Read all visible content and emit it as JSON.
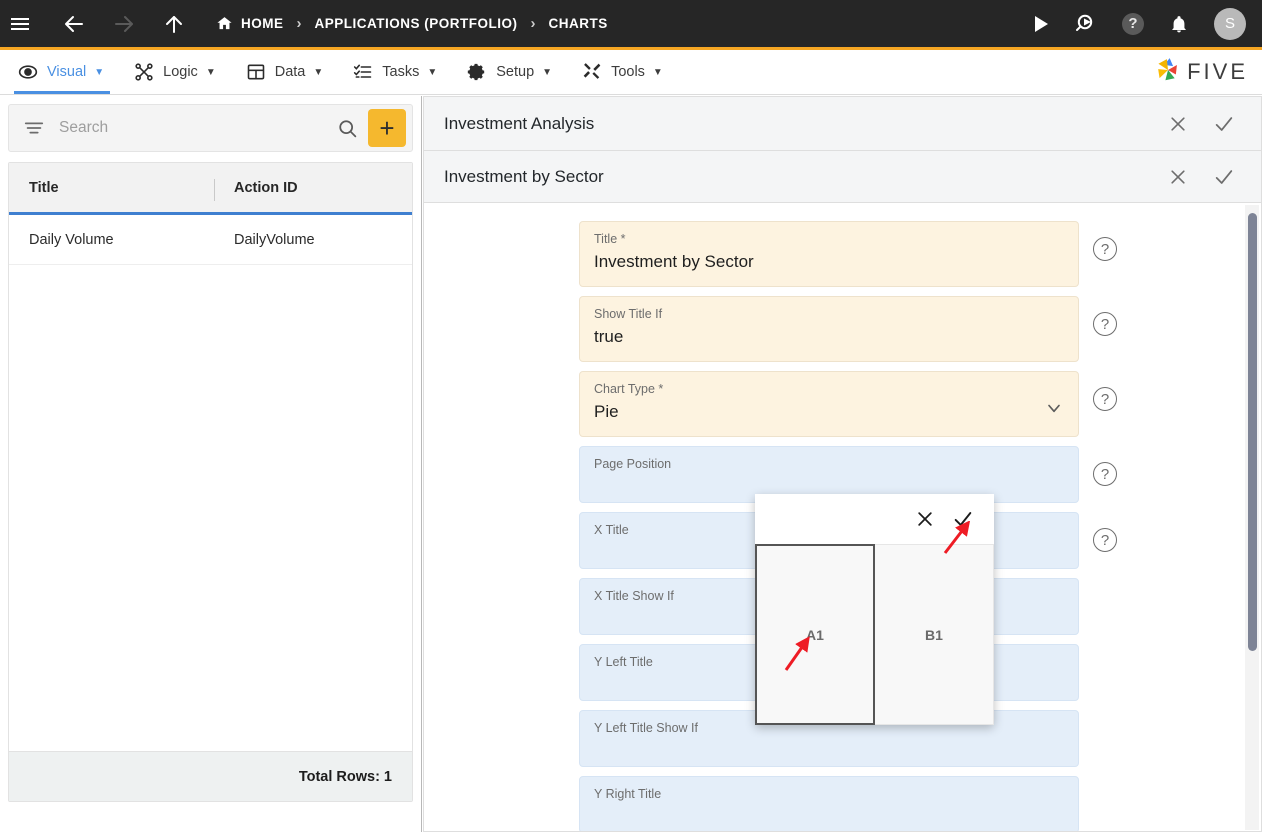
{
  "topbar": {
    "menu_icon": "hamburger-icon",
    "back_icon": "arrow-left-icon",
    "forward_icon": "arrow-right-icon",
    "up_icon": "arrow-up-icon",
    "breadcrumbs": [
      {
        "label": "HOME",
        "icon": "home-icon"
      },
      {
        "label": "APPLICATIONS (PORTFOLIO)",
        "icon": ""
      },
      {
        "label": "CHARTS",
        "icon": ""
      }
    ],
    "separator": "›",
    "actions": [
      {
        "name": "run-icon",
        "glyph": "▶"
      },
      {
        "name": "search-play-icon",
        "glyph": ""
      },
      {
        "name": "help-icon",
        "glyph": "?"
      },
      {
        "name": "notifications-bell-icon",
        "glyph": ""
      }
    ],
    "avatar_initial": "S"
  },
  "menubar": {
    "items": [
      {
        "label": "Visual",
        "icon": "eye-icon",
        "active": true
      },
      {
        "label": "Logic",
        "icon": "logic-nodes-icon",
        "active": false
      },
      {
        "label": "Data",
        "icon": "table-grid-icon",
        "active": false
      },
      {
        "label": "Tasks",
        "icon": "checklist-icon",
        "active": false
      },
      {
        "label": "Setup",
        "icon": "gear-icon",
        "active": false
      },
      {
        "label": "Tools",
        "icon": "tools-icon",
        "active": false
      }
    ],
    "caret": "▼",
    "brand": "FIVE"
  },
  "sidebar": {
    "search": {
      "placeholder": "Search",
      "value": ""
    },
    "filter_icon": "filter-icon",
    "search_icon": "search-icon",
    "add_label": "+",
    "columns": [
      "Title",
      "Action ID"
    ],
    "rows": [
      {
        "title": "Daily Volume",
        "action_id": "DailyVolume"
      }
    ],
    "footer": "Total Rows: 1"
  },
  "main": {
    "outer_panel": {
      "title": "Investment Analysis",
      "close_icon": "close-icon",
      "confirm_icon": "check-icon"
    },
    "inner_panel": {
      "title": "Investment by Sector",
      "close_icon": "close-icon",
      "confirm_icon": "check-icon"
    },
    "fields": [
      {
        "label": "Title *",
        "value": "Investment by Sector",
        "state": "filled",
        "help": true,
        "dropdown": false
      },
      {
        "label": "Show Title If",
        "value": "true",
        "state": "filled",
        "help": true,
        "dropdown": false
      },
      {
        "label": "Chart Type *",
        "value": "Pie",
        "state": "filled",
        "help": true,
        "dropdown": true
      },
      {
        "label": "Page Position",
        "value": "",
        "state": "empty",
        "help": true,
        "dropdown": false
      },
      {
        "label": "X Title",
        "value": "",
        "state": "empty",
        "help": true,
        "dropdown": false
      },
      {
        "label": "X Title Show If",
        "value": "",
        "state": "empty",
        "help": false,
        "dropdown": false
      },
      {
        "label": "Y Left Title",
        "value": "",
        "state": "empty",
        "help": false,
        "dropdown": false
      },
      {
        "label": "Y Left Title Show If",
        "value": "",
        "state": "empty",
        "help": false,
        "dropdown": false
      },
      {
        "label": "Y Right Title",
        "value": "",
        "state": "empty",
        "help": false,
        "dropdown": false
      }
    ]
  },
  "popup": {
    "close_icon": "close-icon",
    "confirm_icon": "check-icon",
    "cells": [
      {
        "label": "A1",
        "selected": true
      },
      {
        "label": "B1",
        "selected": false
      }
    ]
  },
  "annotations": {
    "arrow_color": "#ee1c25",
    "arrows": [
      "pointer-to-a1-cell",
      "pointer-to-confirm-check"
    ]
  },
  "colors": {
    "topbar_bg": "#262626",
    "accent_orange": "#f5a623",
    "accent_blue": "#4a90e2",
    "field_filled": "#fdf3e0",
    "field_empty": "#e4eef9",
    "add_button": "#f5b82e"
  }
}
